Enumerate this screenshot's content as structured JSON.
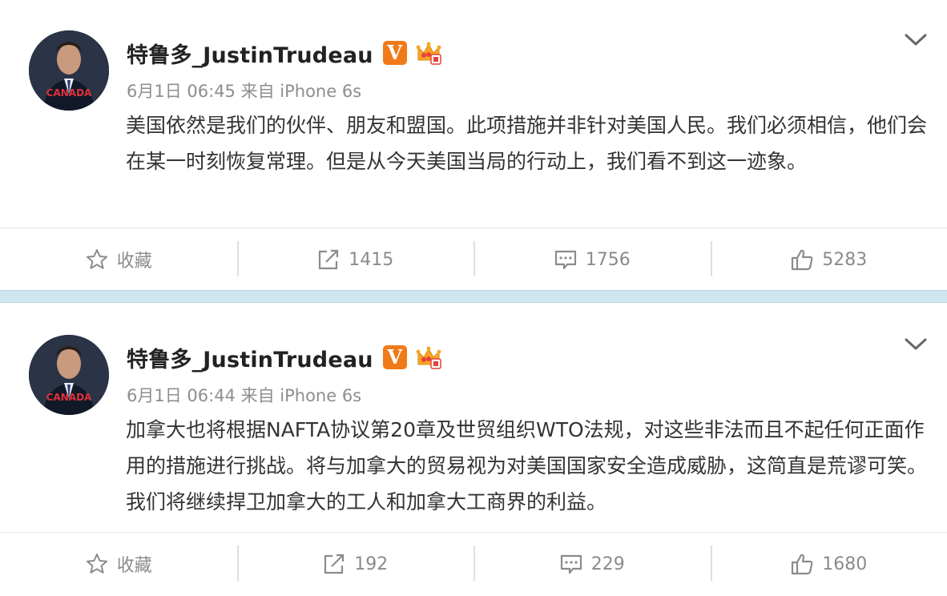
{
  "posts": [
    {
      "author": "特鲁多_JustinTrudeau",
      "badge": "V",
      "meta": "6月1日 06:45 来自 iPhone 6s",
      "content": "美国依然是我们的伙伴、朋友和盟国。此项措施并非针对美国人民。我们必须相信，他们会在某一时刻恢复常理。但是从今天美国当局的行动上，我们看不到这一迹象。",
      "avatar_text": "CANADA",
      "actions": {
        "favorite": "收藏",
        "reposts": "1415",
        "comments": "1756",
        "likes": "5283"
      }
    },
    {
      "author": "特鲁多_JustinTrudeau",
      "badge": "V",
      "meta": "6月1日 06:44 来自 iPhone 6s",
      "content": "加拿大也将根据NAFTA协议第20章及世贸组织WTO法规，对这些非法而且不起任何正面作用的措施进行挑战。将与加拿大的贸易视为对美国国家安全造成威胁，这简直是荒谬可笑。我们将继续捍卫加拿大的工人和加拿大工商界的利益。",
      "avatar_text": "CANADA",
      "actions": {
        "favorite": "收藏",
        "reposts": "192",
        "comments": "229",
        "likes": "1680"
      }
    }
  ],
  "colors": {
    "badge": "#f07a19",
    "separator": "#cfe6f1",
    "meta": "#8e8e8e",
    "action_text": "#8b8b8b"
  },
  "icons": [
    "chevron-down-icon",
    "verified-v-icon",
    "crown-icon",
    "star-icon",
    "repost-icon",
    "comment-icon",
    "thumbs-up-icon"
  ]
}
